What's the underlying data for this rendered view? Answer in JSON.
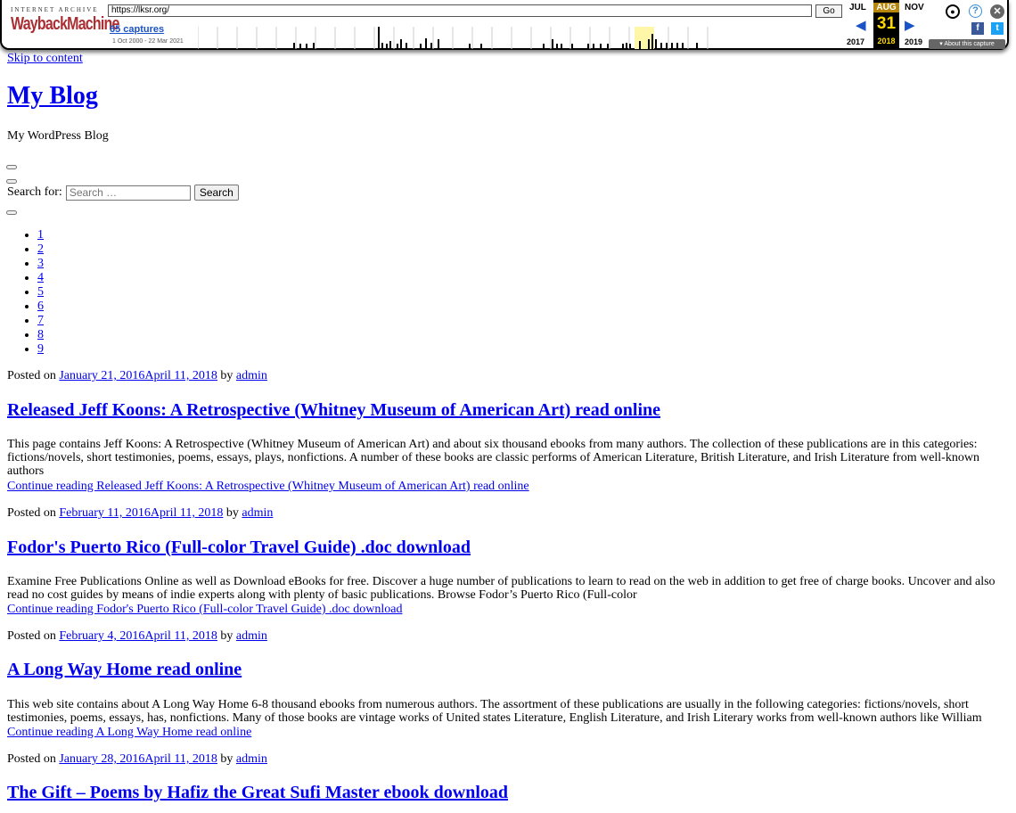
{
  "wayback": {
    "logo_top": "INTERNET ARCHIVE",
    "logo_main": "WaybackMachine",
    "url": "https://lksr.org/",
    "go_label": "Go",
    "captures": "65 captures",
    "range": "1 Oct 2000 - 22 Mar 2021",
    "prev_month": "JUL",
    "cur_month": "AUG",
    "next_month": "NOV",
    "day": "31",
    "prev_year": "2017",
    "cur_year": "2018",
    "next_year": "2019",
    "about": "About this capture",
    "accent": "#1a52c8"
  },
  "page": {
    "skip": "Skip to content",
    "site_title": "My Blog",
    "tagline": "My WordPress Blog",
    "search_label": "Search for:",
    "search_placeholder": "Search …",
    "search_button": "Search",
    "pages": [
      "1",
      "2",
      "3",
      "4",
      "5",
      "6",
      "7",
      "8",
      "9"
    ]
  },
  "posts": [
    {
      "posted_on": "Posted on",
      "date": "January 21, 2016April 11, 2018",
      "by": "by",
      "author": "admin",
      "title": "Released Jeff Koons: A Retrospective (Whitney Museum of American Art) read online",
      "excerpt": "This page contains Jeff Koons: A Retrospective (Whitney Museum of American Art) and about six thousand ebooks from many authors. The collection of these publications are in this categories: fictions/novels, short testimonies, poems, essays, plays, nonfictions. A number of these books are classic performs of American Literature, British Literature, and Irish Literature from well-known authors",
      "continue": "Continue reading Released Jeff Koons: A Retrospective (Whitney Museum of American Art) read online"
    },
    {
      "posted_on": "Posted on",
      "date": "February 11, 2016April 11, 2018",
      "by": "by",
      "author": "admin",
      "title": "Fodor's Puerto Rico (Full-color Travel Guide) .doc download",
      "excerpt": "Examine Free Publications Online as well as Download eBooks for free. Discover a huge number of publications to learn to read on the web in addition to get free of charge books. Uncover and also read no cost guides by means of indie experts along with plenty of basic publications. Browse Fodor’s Puerto Rico (Full-color",
      "continue": "Continue reading Fodor's Puerto Rico (Full-color Travel Guide) .doc download"
    },
    {
      "posted_on": "Posted on",
      "date": "February 4, 2016April 11, 2018",
      "by": "by",
      "author": "admin",
      "title": "A Long Way Home read online",
      "excerpt": "This web site contains about A Long Way Home 6-8 thousand ebooks from numerous authors. The assortment of these publications are usually in the following categories: fictions/novels, short testimonies, poems, essays, has, nonfictions. Many of those books are vintage works of United states Literature, English Literature, and Irish Literary works from well-known authors like William",
      "continue": "Continue reading A Long Way Home read online"
    },
    {
      "posted_on": "Posted on",
      "date": "January 28, 2016April 11, 2018",
      "by": "by",
      "author": "admin",
      "title": "The Gift – Poems by Hafiz the Great Sufi Master ebook download"
    }
  ]
}
